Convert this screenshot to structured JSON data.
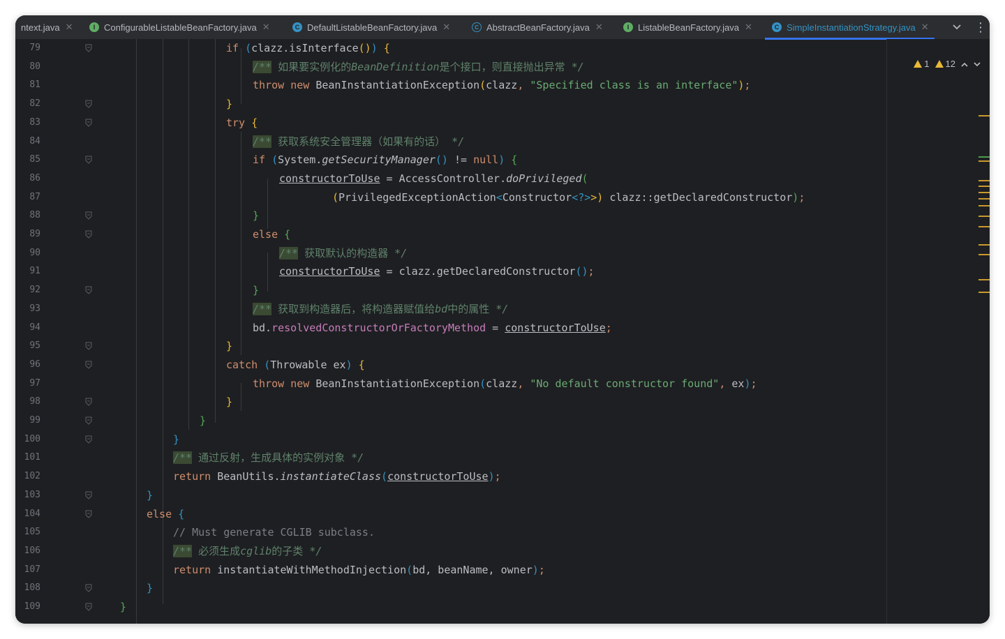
{
  "tabs": [
    {
      "label": "ntext.java",
      "icon": "none",
      "active": false
    },
    {
      "label": "ConfigurableListableBeanFactory.java",
      "icon": "interface-icon",
      "active": false
    },
    {
      "label": "DefaultListableBeanFactory.java",
      "icon": "class-icon",
      "active": false
    },
    {
      "label": "AbstractBeanFactory.java",
      "icon": "abstract-class-icon",
      "active": false
    },
    {
      "label": "ListableBeanFactory.java",
      "icon": "interface-icon",
      "active": false
    },
    {
      "label": "SimpleInstantiationStrategy.java",
      "icon": "class-icon",
      "active": true
    }
  ],
  "inspections": {
    "warnings": "1",
    "weak_warnings": "12"
  },
  "line_numbers": [
    "79",
    "80",
    "81",
    "82",
    "83",
    "84",
    "85",
    "86",
    "87",
    "88",
    "89",
    "90",
    "91",
    "92",
    "93",
    "94",
    "95",
    "96",
    "97",
    "98",
    "99",
    "100",
    "101",
    "102",
    "103",
    "104",
    "105",
    "106",
    "107",
    "108",
    "109"
  ],
  "code": {
    "l79": {
      "kw": "if",
      "rest": "clazz.isInterface",
      "tail": " {"
    },
    "l80": {
      "open": "/**",
      "text": "如果要实例化的",
      "em": "BeanDefinition",
      "text2": "是个接口，则直接抛出异常",
      "close": "*/"
    },
    "l81": {
      "kw1": "throw",
      "kw2": "new",
      "cls": "BeanInstantiationException",
      "arg": "clazz",
      "str": "\"Specified class is an interface\""
    },
    "l82": {
      "brace": "}"
    },
    "l83": {
      "kw": "try",
      "brace": "{"
    },
    "l84": {
      "open": "/**",
      "text": "获取系统安全管理器（如果有的话）",
      "close": "*/"
    },
    "l85": {
      "kw": "if",
      "cls": "System.",
      "method": "getSecurityManager",
      "op": " != ",
      "nul": "null",
      "brace": "{"
    },
    "l86": {
      "var": "constructorToUse",
      "assign": " = AccessController.",
      "method": "doPrivileged"
    },
    "l87": {
      "cast": "PrivilegedExceptionAction",
      "generic": "Constructor",
      "wild": "<?>",
      "ref": "clazz::getDeclaredConstructor"
    },
    "l88": {
      "brace": "}"
    },
    "l89": {
      "kw": "else",
      "brace": "{"
    },
    "l90": {
      "open": "/**",
      "text": "获取默认的构造器",
      "close": "*/"
    },
    "l91": {
      "var": "constructorToUse",
      "rest": " = clazz.getDeclaredConstructor"
    },
    "l92": {
      "brace": "}"
    },
    "l93": {
      "open": "/**",
      "text": "获取到构造器后，将构造器赋值给",
      "em": "bd",
      "text2": "中的属性",
      "close": "*/"
    },
    "l94": {
      "obj": "bd.",
      "field": "resolvedConstructorOrFactoryMethod",
      "op": " = ",
      "var": "constructorToUse"
    },
    "l95": {
      "brace": "}"
    },
    "l96": {
      "kw": "catch",
      "type": "Throwable ex",
      "brace": "{"
    },
    "l97": {
      "kw1": "throw",
      "kw2": "new",
      "cls": "BeanInstantiationException",
      "arg": "clazz",
      "str": "\"No default constructor found\"",
      "arg2": "ex"
    },
    "l98": {
      "brace": "}"
    },
    "l99": {
      "brace": "}"
    },
    "l100": {
      "brace": "}"
    },
    "l101": {
      "open": "/**",
      "text": "通过反射，生成具体的实例对象",
      "close": "*/"
    },
    "l102": {
      "kw": "return",
      "obj": "BeanUtils.",
      "method": "instantiateClass",
      "var": "constructorToUse"
    },
    "l103": {
      "brace": "}"
    },
    "l104": {
      "kw": "else",
      "brace": "{"
    },
    "l105": {
      "comment": "// Must generate CGLIB subclass."
    },
    "l106": {
      "open": "/**",
      "text": "必须生成",
      "em": "cglib",
      "text2": "的子类",
      "close": "*/"
    },
    "l107": {
      "kw": "return",
      "call": "instantiateWithMethodInjection",
      "args": "bd, beanName, owner"
    },
    "l108": {
      "brace": "}"
    },
    "l109": {
      "brace": "}"
    }
  }
}
